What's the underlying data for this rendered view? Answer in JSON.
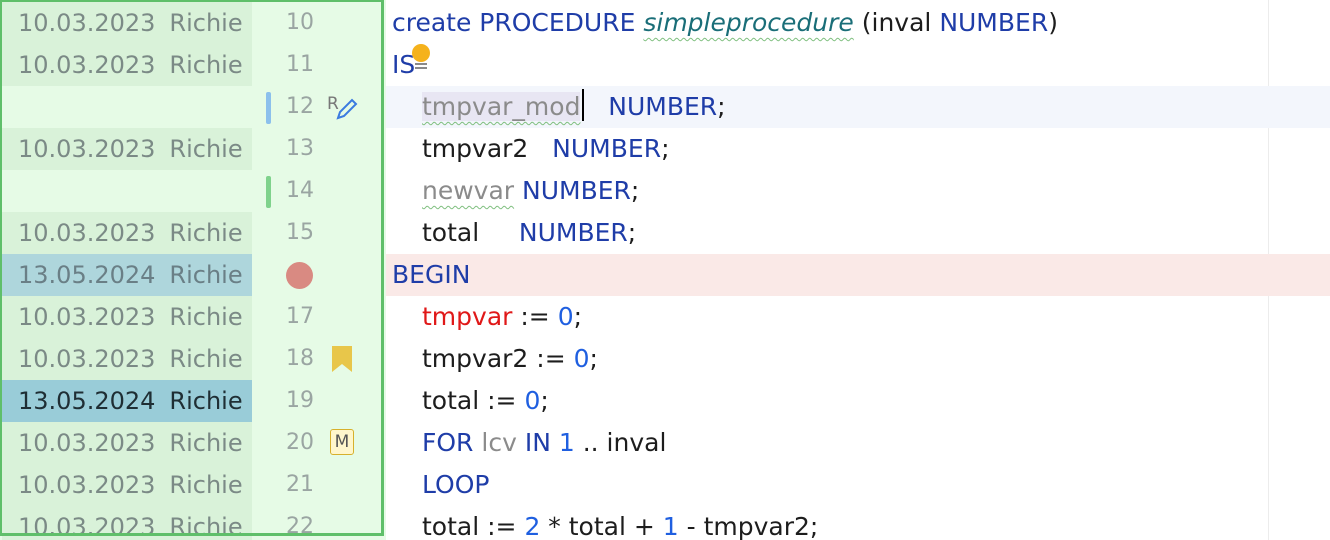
{
  "gutter": {
    "rows": [
      {
        "date": "10.03.2023",
        "author": "Richie",
        "line": "10"
      },
      {
        "date": "10.03.2023",
        "author": "Richie",
        "line": "11"
      },
      {
        "date": "",
        "author": "",
        "line": "12"
      },
      {
        "date": "10.03.2023",
        "author": "Richie",
        "line": "13"
      },
      {
        "date": "",
        "author": "",
        "line": "14"
      },
      {
        "date": "10.03.2023",
        "author": "Richie",
        "line": "15"
      },
      {
        "date": "13.05.2024",
        "author": "Richie",
        "line": ""
      },
      {
        "date": "10.03.2023",
        "author": "Richie",
        "line": "17"
      },
      {
        "date": "10.03.2023",
        "author": "Richie",
        "line": "18"
      },
      {
        "date": "13.05.2024",
        "author": "Richie",
        "line": "19"
      },
      {
        "date": "10.03.2023",
        "author": "Richie",
        "line": "20"
      },
      {
        "date": "10.03.2023",
        "author": "Richie",
        "line": "21"
      },
      {
        "date": "10.03.2023",
        "author": "Richie",
        "line": "22"
      }
    ],
    "mnemonic_bookmark_label": "M",
    "rename_icon_label": "R"
  },
  "code": {
    "l10": {
      "kw_create": "create PROCEDURE ",
      "name": "simpleprocedure",
      "open": " (inval ",
      "type": "NUMBER",
      "close": ")"
    },
    "l11": {
      "kw": "IS"
    },
    "l12": {
      "ident": "tmpvar_mod",
      "sep": "   ",
      "type": "NUMBER",
      "end": ";"
    },
    "l13": {
      "ident": "tmpvar2   ",
      "type": "NUMBER",
      "end": ";"
    },
    "l14": {
      "ident": "newvar",
      "sep": " ",
      "type": "NUMBER",
      "end": ";"
    },
    "l15": {
      "ident": "total     ",
      "type": "NUMBER",
      "end": ";"
    },
    "l16": {
      "kw": "BEGIN"
    },
    "l17": {
      "ident": "tmpvar",
      "op": " := ",
      "num": "0",
      "end": ";"
    },
    "l18": {
      "ident": "tmpvar2 := ",
      "num": "0",
      "end": ";"
    },
    "l19": {
      "ident": "total := ",
      "num": "0",
      "end": ";"
    },
    "l20": {
      "kw_for": "FOR ",
      "var": "lcv",
      "kw_in": " IN ",
      "num": "1",
      "rest": " .. inval"
    },
    "l21": {
      "kw": "LOOP"
    },
    "l22": {
      "a": "total := ",
      "n2": "2",
      "b": " * total + ",
      "n1": "1",
      "c": " - tmpvar2;"
    }
  },
  "colors": {
    "gutter_bg": "#e6fbe6",
    "gutter_border": "#5fbf6a",
    "keyword": "#1f3da8",
    "number": "#1f5fe0",
    "error": "#e01818",
    "breakpoint": "#d98a82",
    "bookmark": "#e8c64a"
  }
}
